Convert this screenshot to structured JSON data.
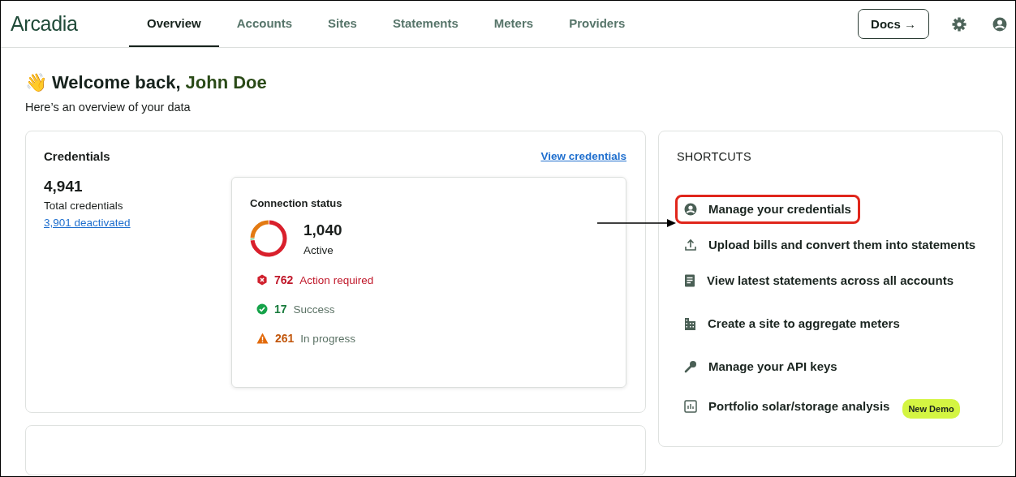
{
  "header": {
    "logo": "Arcadia",
    "nav": [
      {
        "label": "Overview",
        "selected": true
      },
      {
        "label": "Accounts",
        "selected": false
      },
      {
        "label": "Sites",
        "selected": false
      },
      {
        "label": "Statements",
        "selected": false
      },
      {
        "label": "Meters",
        "selected": false
      },
      {
        "label": "Providers",
        "selected": false
      }
    ],
    "docs_button": "Docs →"
  },
  "welcome": {
    "emoji": "👋",
    "greeting": "Welcome back,",
    "name": "John Doe",
    "subtitle": "Here’s an overview of your data"
  },
  "credentials": {
    "title": "Credentials",
    "link": "View credentials",
    "total": "4,941",
    "total_label": "Total credentials",
    "deactivated": "3,901 deactivated",
    "connection": {
      "title": "Connection status",
      "active": "1,040",
      "active_label": "Active",
      "statuses": [
        {
          "kind": "error",
          "count": "762",
          "label": "Action required"
        },
        {
          "kind": "success",
          "count": "17",
          "label": "Success"
        },
        {
          "kind": "warning",
          "count": "261",
          "label": "In progress"
        }
      ]
    }
  },
  "shortcuts": {
    "title": "SHORTCUTS",
    "items": [
      {
        "kind": "person",
        "label": "Manage your credentials",
        "highlighted": true
      },
      {
        "kind": "upload",
        "label": "Upload bills and convert them into statements",
        "highlighted": false
      },
      {
        "kind": "document",
        "label": "View latest statements across all accounts",
        "highlighted": false
      },
      {
        "kind": "building",
        "label": "Create a site to aggregate meters",
        "highlighted": false
      },
      {
        "kind": "key",
        "label": "Manage your API keys",
        "highlighted": false
      },
      {
        "kind": "chart",
        "label": "Portfolio solar/storage analysis",
        "highlighted": false,
        "badge": "New Demo"
      }
    ]
  }
}
